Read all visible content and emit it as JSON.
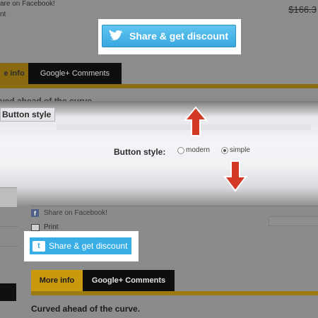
{
  "top": {
    "fb_partial": "are on Facebook!",
    "nt_partial": "nt",
    "price": "$166.3",
    "share_button": "Share & get discount",
    "tabs": [
      "e info",
      "Google+ Comments"
    ],
    "curved_text": "ved ahead of the curve."
  },
  "middle": {
    "button_style_tag": "Button style",
    "label": "Button style:",
    "options": [
      "modern",
      "simple"
    ],
    "selected": "simple"
  },
  "bottom": {
    "share_facebook": "Share on Facebook!",
    "print": "Print",
    "share_button": "Share & get discount",
    "tabs": [
      "More info",
      "Google+ Comments"
    ],
    "curved_text": "Curved ahead of the curve."
  },
  "colors": {
    "arrow": "#d33a25",
    "share_blue": "#39ade6",
    "gold": "#c99a0e"
  },
  "icons": [
    "facebook-icon",
    "printer-icon",
    "twitter-bird-icon",
    "arrow-up-icon",
    "arrow-down-icon"
  ]
}
